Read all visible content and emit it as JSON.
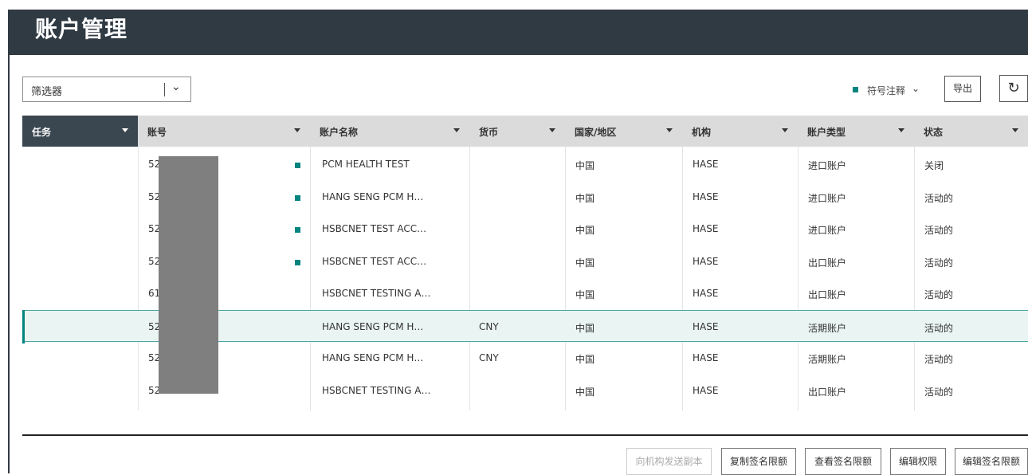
{
  "header": {
    "title": "账户管理"
  },
  "filter": {
    "label": "筛选器",
    "chevron": "⌄"
  },
  "legend": {
    "label": "符号注释",
    "chevron": "⌄",
    "marker_color": "#00847f"
  },
  "toolbar": {
    "export_label": "导出",
    "refresh_icon": "refresh-icon"
  },
  "table": {
    "columns": [
      "任务",
      "账号",
      "账户名称",
      "货币",
      "国家/地区",
      "机构",
      "账户类型",
      "状态"
    ],
    "rows": [
      {
        "account": "52   -190",
        "marked": true,
        "name": "PCM HEALTH TEST",
        "currency": "",
        "country": "中国",
        "institution": "HASE",
        "type": "进口账户",
        "status": "关闭",
        "selected": false
      },
      {
        "account": "52",
        "marked": true,
        "name": "HANG SENG PCM H…",
        "currency": "",
        "country": "中国",
        "institution": "HASE",
        "type": "进口账户",
        "status": "活动的",
        "selected": false
      },
      {
        "account": "520",
        "marked": true,
        "name": "HSBCNET TEST ACC…",
        "currency": "",
        "country": "中国",
        "institution": "HASE",
        "type": "进口账户",
        "status": "活动的",
        "selected": false
      },
      {
        "account": "520",
        "marked": true,
        "name": "HSBCNET TEST ACC…",
        "currency": "",
        "country": "中国",
        "institution": "HASE",
        "type": "出口账户",
        "status": "活动的",
        "selected": false
      },
      {
        "account": "61   180",
        "marked": false,
        "name": "HSBCNET TESTING A…",
        "currency": "",
        "country": "中国",
        "institution": "HASE",
        "type": "出口账户",
        "status": "活动的",
        "selected": false
      },
      {
        "account": "52   020",
        "marked": false,
        "name": "HANG SENG PCM H…",
        "currency": "CNY",
        "country": "中国",
        "institution": "HASE",
        "type": "活期账户",
        "status": "活动的",
        "selected": true
      },
      {
        "account": "52   018",
        "marked": false,
        "name": "HANG SENG PCM H…",
        "currency": "CNY",
        "country": "中国",
        "institution": "HASE",
        "type": "活期账户",
        "status": "活动的",
        "selected": false
      },
      {
        "account": "52   190",
        "marked": false,
        "name": "HSBCNET TESTING A…",
        "currency": "",
        "country": "中国",
        "institution": "HASE",
        "type": "出口账户",
        "status": "活动的",
        "selected": false
      }
    ]
  },
  "actions": {
    "send_copy": "向机构发送副本",
    "copy_limit": "复制签名限额",
    "view_limit": "查看签名限额",
    "edit_permission": "编辑权限",
    "edit_limit": "编辑签名限额"
  }
}
